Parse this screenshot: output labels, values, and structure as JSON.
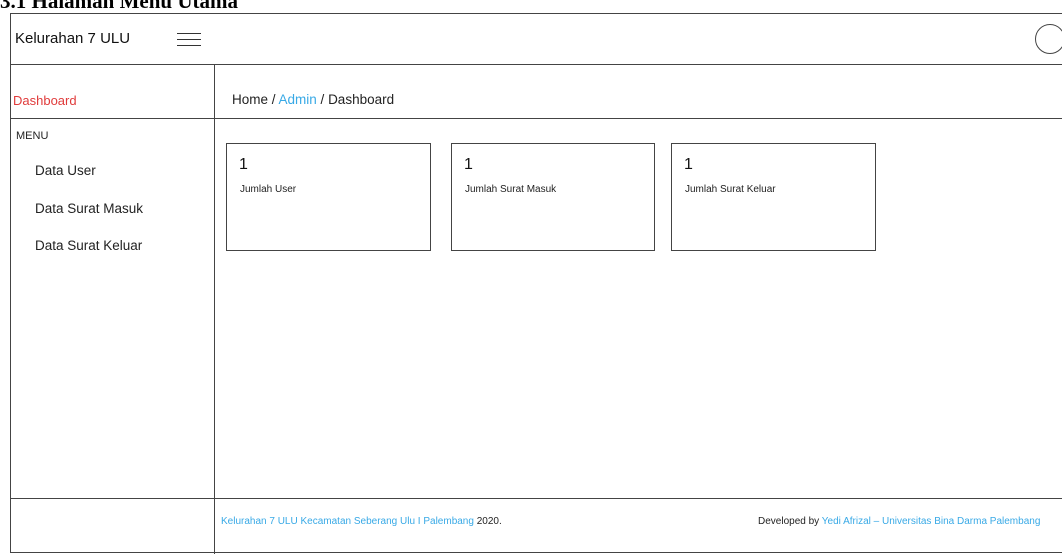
{
  "document": {
    "heading": "3.1 Halaman Menu Utama"
  },
  "topbar": {
    "brand": "Kelurahan 7 ULU"
  },
  "sidebar": {
    "active": "Dashboard",
    "menu_title": "MENU",
    "items": [
      {
        "label": "Data User"
      },
      {
        "label": "Data Surat Masuk"
      },
      {
        "label": "Data Surat Keluar"
      }
    ]
  },
  "breadcrumb": {
    "home": "Home",
    "sep": " / ",
    "admin": "Admin",
    "current": "Dashboard"
  },
  "cards": [
    {
      "count": "1",
      "label": "Jumlah User"
    },
    {
      "count": "1",
      "label": "Jumlah Surat Masuk"
    },
    {
      "count": "1",
      "label": "Jumlah Surat Keluar"
    }
  ],
  "footer": {
    "left_link": "Kelurahan 7 ULU Kecamatan Seberang Ulu I Palembang",
    "left_year": " 2020.",
    "right_prefix": "Developed by ",
    "right_link": "Yedi Afrizal – Universitas Bina Darma Palembang"
  },
  "colors": {
    "active": "#e03b3b",
    "link": "#38a9e6",
    "border": "#444444"
  }
}
